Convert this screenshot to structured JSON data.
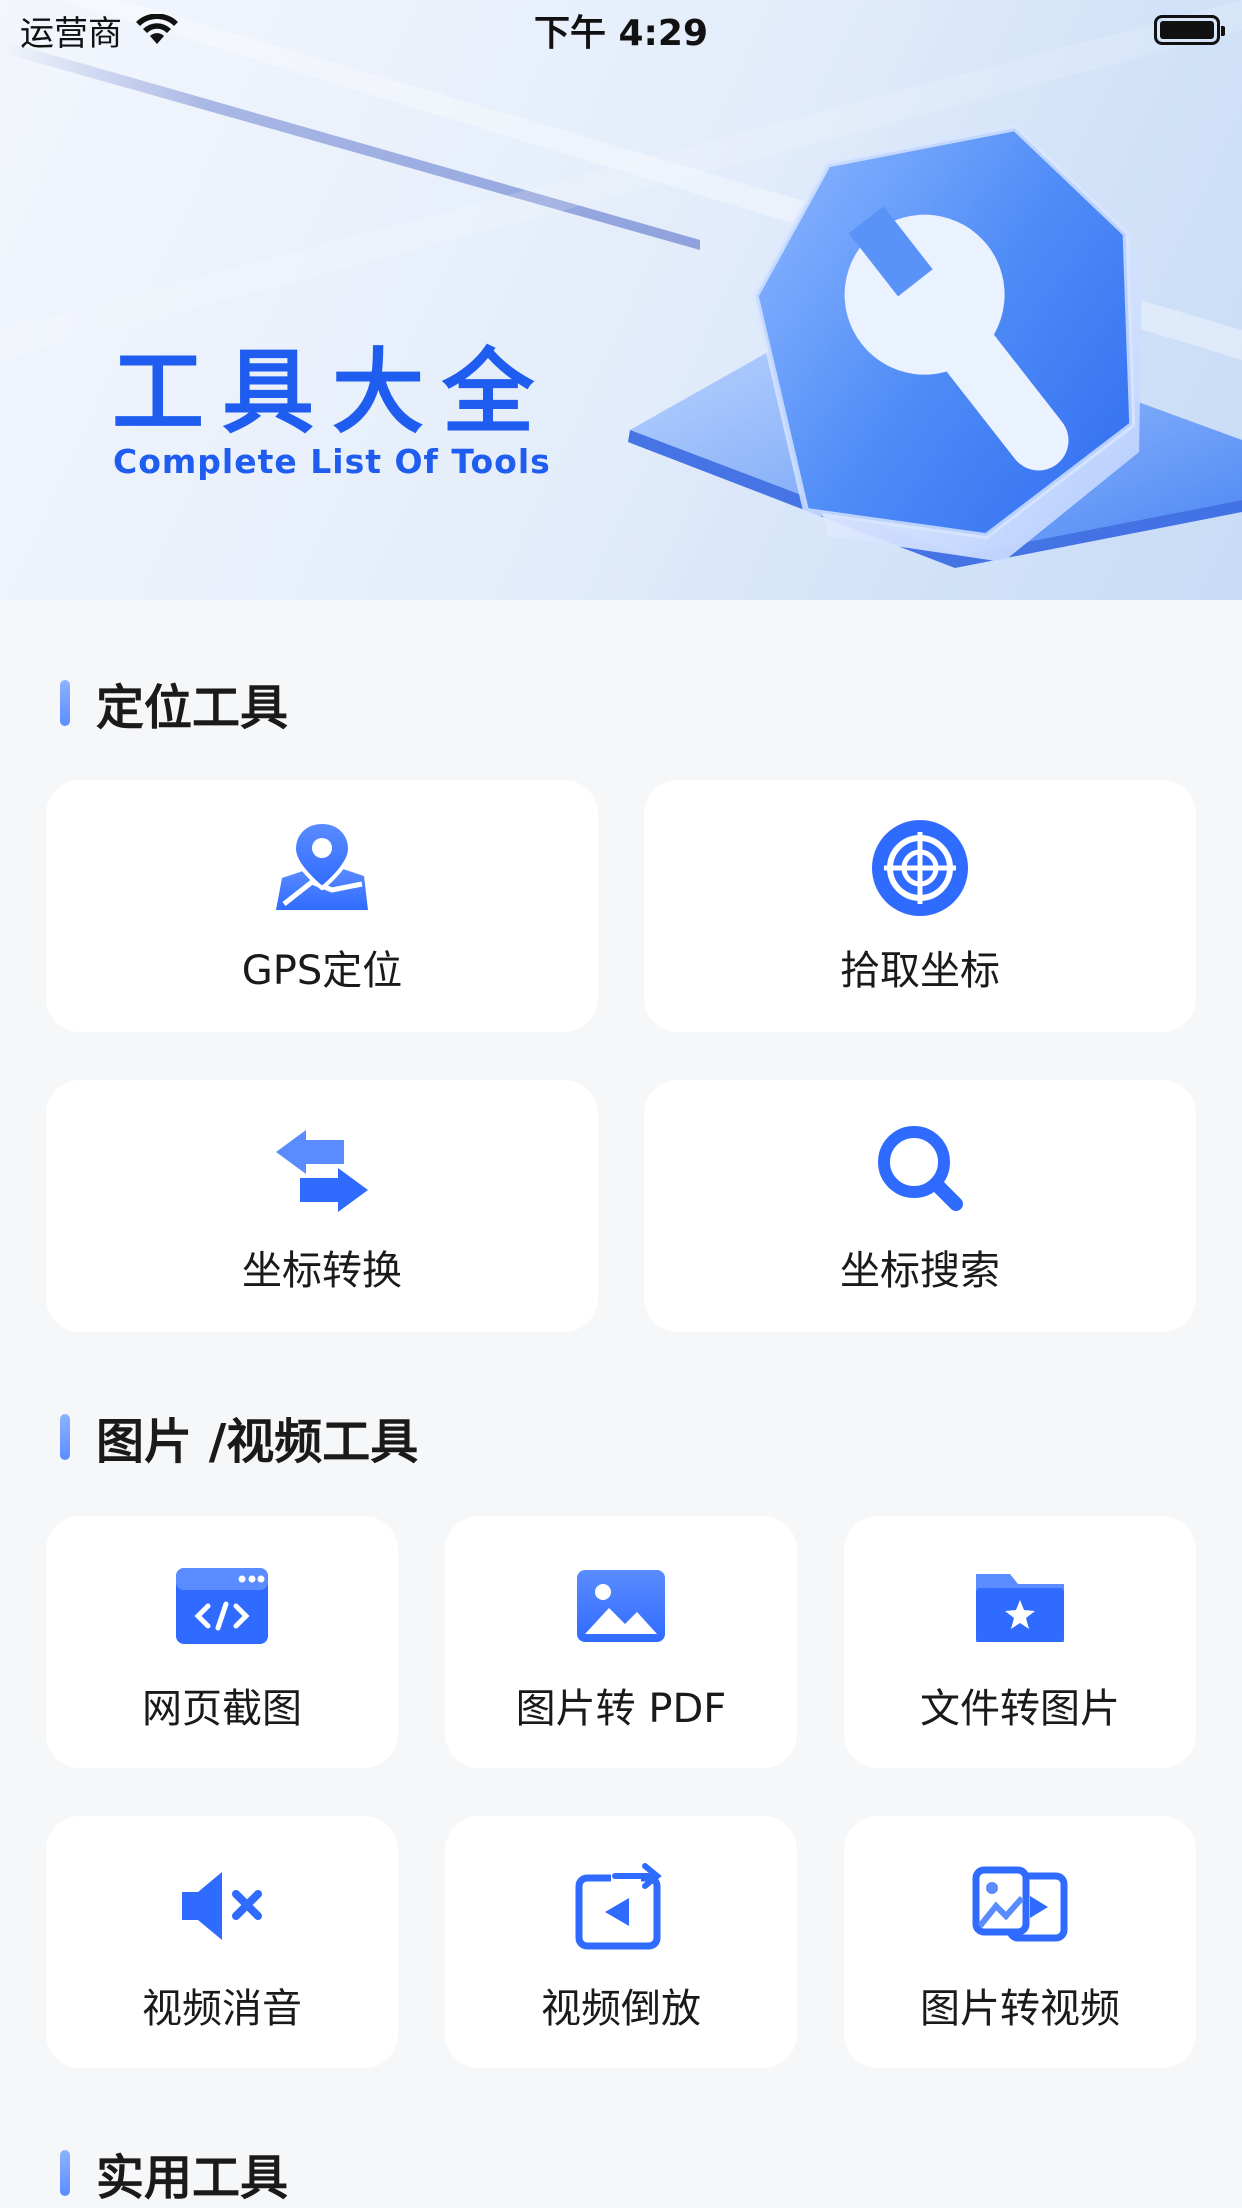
{
  "status_bar": {
    "carrier": "运营商",
    "time": "下午 4:29"
  },
  "hero": {
    "title": "工具大全",
    "subtitle": "Complete List Of Tools"
  },
  "sections": [
    {
      "title": "定位工具",
      "items": [
        {
          "label": "GPS定位",
          "icon": "map-pin-icon"
        },
        {
          "label": "拾取坐标",
          "icon": "target-icon"
        },
        {
          "label": "坐标转换",
          "icon": "swap-arrows-icon"
        },
        {
          "label": "坐标搜索",
          "icon": "search-icon"
        }
      ]
    },
    {
      "title": "图片 /视频工具",
      "items": [
        {
          "label": "网页截图",
          "icon": "web-code-icon"
        },
        {
          "label": "图片转 PDF",
          "icon": "image-icon"
        },
        {
          "label": "文件转图片",
          "icon": "folder-star-icon"
        },
        {
          "label": "视频消音",
          "icon": "mute-icon"
        },
        {
          "label": "视频倒放",
          "icon": "reverse-play-icon"
        },
        {
          "label": "图片转视频",
          "icon": "image-to-video-icon"
        }
      ]
    },
    {
      "title": "实用工具",
      "items": []
    }
  ],
  "colors": {
    "accent": "#2f6bff",
    "accent_light": "#5b8cff",
    "title_blue": "#1f5cf0",
    "background": "#f6f7f9",
    "card": "#ffffff"
  }
}
